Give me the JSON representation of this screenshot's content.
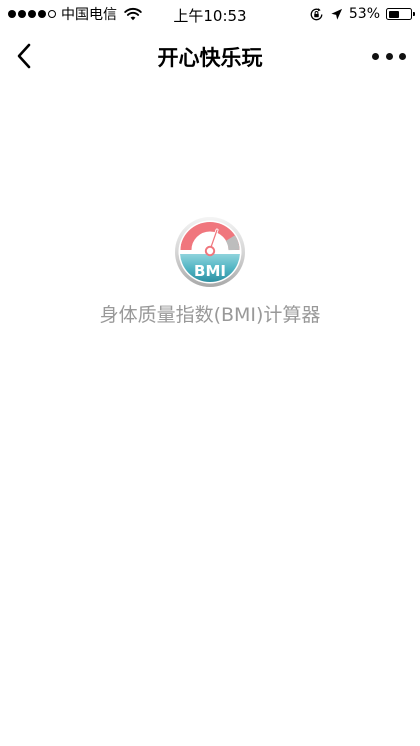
{
  "status_bar": {
    "carrier": "中国电信",
    "time": "上午10:53",
    "battery_percent": "53%",
    "battery_level": 0.53,
    "signal_bars_filled": 4,
    "signal_bars_total": 5,
    "icons": [
      "signal-dots-icon",
      "wifi-icon",
      "rotation-lock-icon",
      "location-arrow-icon",
      "battery-icon"
    ]
  },
  "nav": {
    "title": "开心快乐玩",
    "icons": [
      "back-chevron-icon",
      "more-dots-icon"
    ]
  },
  "app": {
    "label": "身体质量指数(BMI)计算器",
    "icon_text": "BMI",
    "icon": "bmi-gauge-icon",
    "colors": {
      "gauge_pink": "#f0767d",
      "gauge_teal": "#4fb3c2",
      "label_gray": "#999999"
    }
  }
}
